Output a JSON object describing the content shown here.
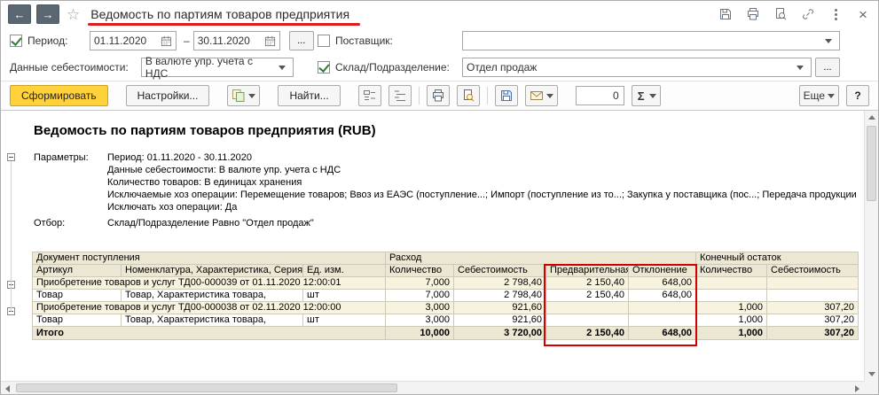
{
  "icons": {
    "back": "←",
    "forward": "→",
    "star": "☆",
    "close": "×"
  },
  "window": {
    "title": "Ведомость по партиям товаров предприятия"
  },
  "filters": {
    "period_label": "Период:",
    "period_from": "01.11.2020",
    "period_dash": "–",
    "period_to": "30.11.2020",
    "period_more": "...",
    "supplier_label": "Поставщик:",
    "supplier_value": "",
    "cost_label": "Данные себестоимости:",
    "cost_value": "В валюте упр. учета с НДС",
    "warehouse_label": "Склад/Подразделение:",
    "warehouse_value": "Отдел продаж",
    "warehouse_more": "..."
  },
  "toolbar": {
    "generate": "Сформировать",
    "settings": "Настройки...",
    "find": "Найти...",
    "counter": "0",
    "sigma": "Σ",
    "more": "Еще",
    "help": "?"
  },
  "report": {
    "title": "Ведомость по партиям товаров предприятия (RUB)",
    "params_label": "Параметры:",
    "param_period": "Период: 01.11.2020 - 30.11.2020",
    "param_cost": "Данные себестоимости: В валюте упр. учета с НДС",
    "param_qty": "Количество товаров: В единицах хранения",
    "param_excluded": "Исключаемые хоз операции: Перемещение товаров; Ввоз из ЕАЭС (поступление...; Импорт (поступление из то...; Закупка у поставщика (пос...; Передача продукции",
    "param_exclude_flag": "Исключать хоз операции: Да",
    "filter_label": "Отбор:",
    "filter_value": "Склад/Подразделение Равно \"Отдел продаж\""
  },
  "table": {
    "h_doc": "Документ поступления",
    "h_expense": "Расход",
    "h_final": "Конечный остаток",
    "c_art": "Артикул",
    "c_nom": "Номенклатура, Характеристика, Серия",
    "c_unit": "Ед. изм.",
    "c_qty": "Количество",
    "c_cost": "Себестоимость",
    "c_prelim": "Предварительная",
    "c_dev": "Отклонение",
    "c_qty2": "Количество",
    "c_cost2": "Себестоимость",
    "rows": [
      {
        "doc": "Приобретение товаров и услуг ТД00-000039 от 01.11.2020 12:00:01",
        "qty": "7,000",
        "cost": "2 798,40",
        "prelim": "2 150,40",
        "dev": "648,00",
        "eqty": "",
        "ecost": ""
      },
      {
        "art": "Товар",
        "nom": "Товар, Характеристика товара,",
        "unit": "шт",
        "qty": "7,000",
        "cost": "2 798,40",
        "prelim": "2 150,40",
        "dev": "648,00",
        "eqty": "",
        "ecost": ""
      },
      {
        "doc": "Приобретение товаров и услуг ТД00-000038 от 02.11.2020 12:00:00",
        "qty": "3,000",
        "cost": "921,60",
        "prelim": "",
        "dev": "",
        "eqty": "1,000",
        "ecost": "307,20"
      },
      {
        "art": "Товар",
        "nom": "Товар, Характеристика товара,",
        "unit": "шт",
        "qty": "3,000",
        "cost": "921,60",
        "prelim": "",
        "dev": "",
        "eqty": "1,000",
        "ecost": "307,20"
      }
    ],
    "total": {
      "label": "Итого",
      "qty": "10,000",
      "cost": "3 720,00",
      "prelim": "2 150,40",
      "dev": "648,00",
      "eqty": "1,000",
      "ecost": "307,20"
    }
  }
}
